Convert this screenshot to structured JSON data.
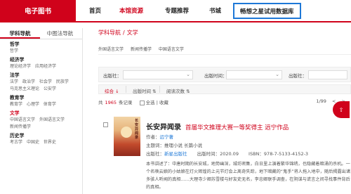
{
  "nav": {
    "brand": "电子图书",
    "items": [
      "首页",
      "本馆资源",
      "专题推荐",
      "书城"
    ],
    "trial": "畅想之星试用数据库"
  },
  "sidebar": {
    "tabs": [
      "学科导航",
      "中图法导航"
    ],
    "categories": [
      {
        "title": "哲学",
        "subs": [
          "哲学"
        ]
      },
      {
        "title": "经济学",
        "subs": [
          "理论经济学",
          "应用经济学"
        ]
      },
      {
        "title": "法学",
        "subs": [
          "法学",
          "政治学",
          "社会学",
          "民族学",
          "马克思主义理论",
          "公安学"
        ]
      },
      {
        "title": "教育学",
        "subs": [
          "教育学",
          "心理学",
          "体育学"
        ]
      },
      {
        "title": "文学",
        "subs": [
          "中国语言文学",
          "外国语言文学",
          "新闻传播学"
        ]
      },
      {
        "title": "历史学",
        "subs": [
          "考古学",
          "中国史",
          "世界史"
        ]
      }
    ]
  },
  "main": {
    "crumb": [
      "学科导航",
      "文学"
    ],
    "crumb_sub": [
      "外国语言文学",
      "新闻传播学",
      "中国语言文学"
    ],
    "filters": {
      "publisher_label": "出版社：",
      "pubtime_label": "出版时间：",
      "publisher2_label": "出版社："
    },
    "sort": {
      "composite": "综合",
      "pubtime": "出版时间",
      "reads": "阅读次数"
    },
    "count": {
      "prefix": "共",
      "num": "1965",
      "suffix": "条记录",
      "select_all": "全选",
      "favorite": "收藏"
    },
    "pager": {
      "page": "1/99",
      "prev": "<",
      "next": ">"
    }
  },
  "book": {
    "title": "长安异闻录",
    "award": "首届华文推理大赛一等奖得主  远宁作品",
    "author_label": "作者：",
    "author": "远宁著",
    "subject_label": "主题词：",
    "subject": "推理小说 长篇小说",
    "publisher_label": "出版社：",
    "publisher": "新星出版社",
    "pubtime_label": "出版时间：",
    "pubtime": "2020.09",
    "isbn_label": "ISBN：",
    "isbn": "978-7-5133-4152-3",
    "desc": "本书讲述了：中唐时期的长安城，地势幽深，城坊密集，白日里上演着繁华锦绣，也隐藏着暗涌的杀机。一个名唤云娘的小姑娘在灯火辉煌的上元节灯会上离奇失踪，地下暗藏的“鬼手”将人拖入地中，随后揭露出诸多骇人听闻的真相……大理寺少卿苏雪楼与好友史无名，李忠卿联手调查，在阴谋与谎言之间寻找事件背后的真相。",
    "cover_text": "长安异闻录"
  },
  "fab": "⇧"
}
